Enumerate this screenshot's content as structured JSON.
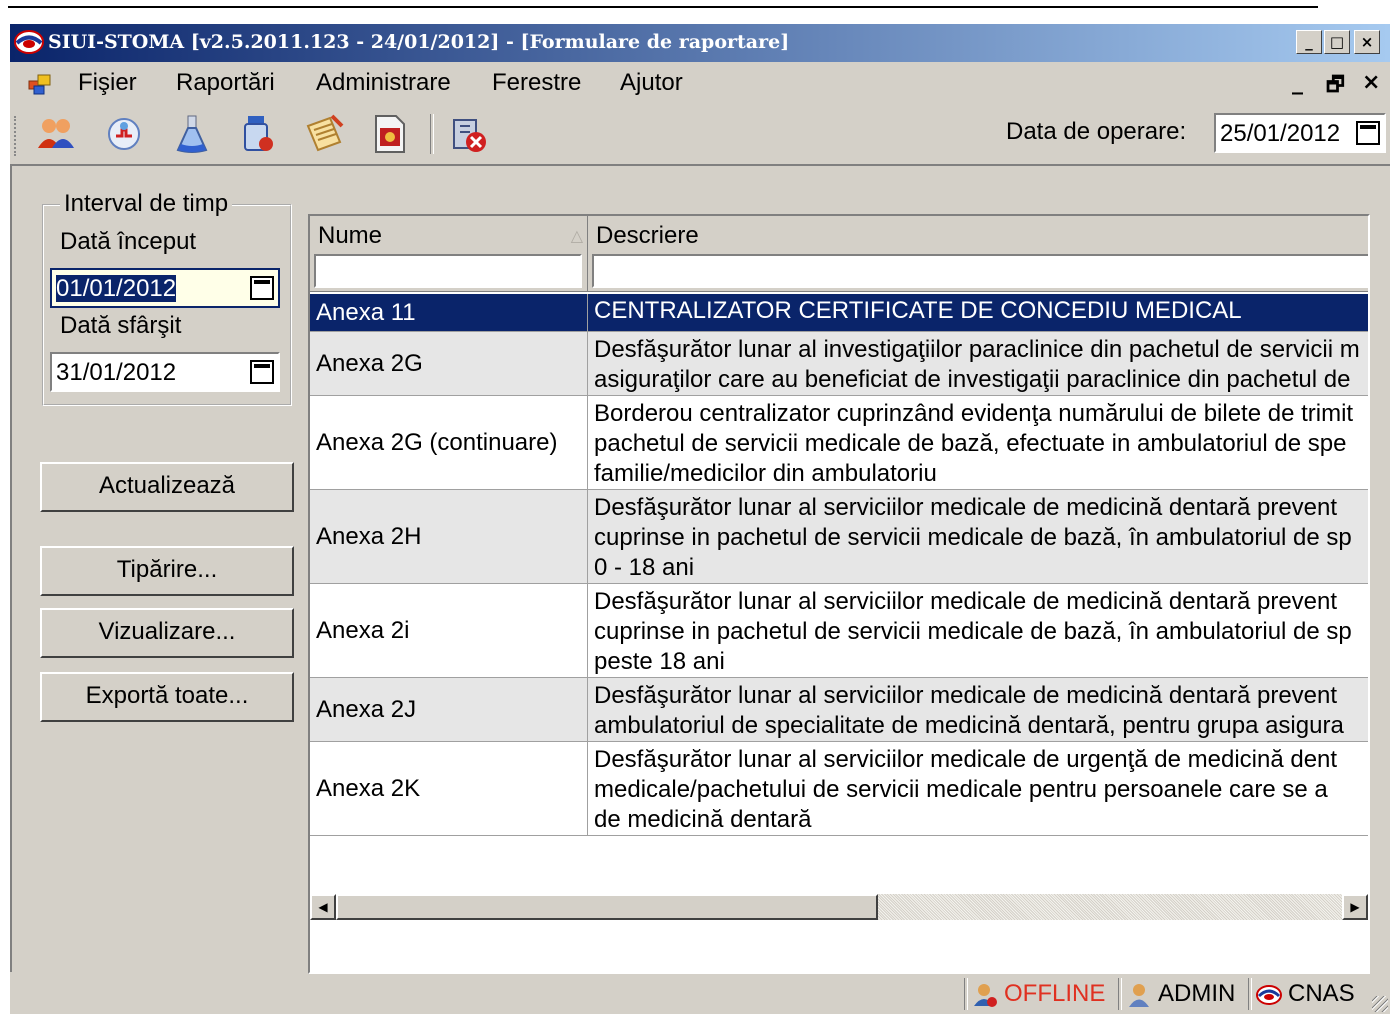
{
  "window": {
    "title": "SIUI-STOMA [v2.5.2011.123 - 24/01/2012] - [Formulare de raportare]",
    "minimize": "_",
    "maximize": "□",
    "close": "×"
  },
  "menu": {
    "items": [
      "Fişier",
      "Raportări",
      "Administrare",
      "Ferestre",
      "Ajutor"
    ],
    "mdi_minimize": "_",
    "mdi_restore": "🗗",
    "mdi_close": "×"
  },
  "toolbar": {
    "icons": [
      "users-icon",
      "medical-cross-icon",
      "lab-flask-icon",
      "medicine-bottle-icon",
      "notepad-icon",
      "document-certificate-icon",
      "exit-icon"
    ],
    "operation_date_label": "Data de operare:",
    "operation_date": "25/01/2012"
  },
  "sidebar": {
    "interval_legend": "Interval de timp",
    "start_label": "Dată început",
    "start_value": "01/01/2012",
    "end_label": "Dată sfârşit",
    "end_value": "31/01/2012",
    "buttons": {
      "refresh": "Actualizează",
      "print": "Tipărire...",
      "preview": "Vizualizare...",
      "export": "Exportă toate..."
    }
  },
  "grid": {
    "columns": [
      "Nume",
      "Descriere"
    ],
    "sort_indicator": "△",
    "rows": [
      {
        "name": "Anexa 11",
        "description": "CENTRALIZATOR CERTIFICATE DE CONCEDIU MEDICAL"
      },
      {
        "name": "Anexa 2G",
        "description": "Desfăşurător lunar al investigaţiilor paraclinice din pachetul de servicii m\nasiguraţilor care au beneficiat de investigaţii paraclinice din pachetul de"
      },
      {
        "name": "Anexa 2G (continuare)",
        "description": "Borderou centralizator cuprinzând evidenţa numărului de bilete de trimit\npachetul de servicii medicale de bază, efectuate in ambulatoriul de spe\nfamilie/medicilor din ambulatoriu"
      },
      {
        "name": "Anexa 2H",
        "description": "Desfăşurător lunar al serviciilor medicale de medicină dentară prevent\ncuprinse in pachetul de servicii medicale de bază, în ambulatoriul de sp\n0 - 18 ani"
      },
      {
        "name": "Anexa 2i",
        "description": "Desfăşurător lunar al serviciilor medicale de medicină dentară prevent\ncuprinse in pachetul de servicii medicale de bază, în ambulatoriul de sp\npeste 18 ani"
      },
      {
        "name": "Anexa 2J",
        "description": "Desfăşurător lunar al serviciilor medicale de medicină dentară prevent\nambulatoriul de specialitate de medicină dentară, pentru grupa asigura"
      },
      {
        "name": "Anexa 2K",
        "description": "Desfăşurător lunar al serviciilor medicale de urgenţă de medicină dent\nmedicale/pachetului de servicii medicale pentru persoanele care se a\nde medicină dentară"
      }
    ]
  },
  "status": {
    "connection": "OFFLINE",
    "connection_color": "#e03020",
    "user": "ADMIN",
    "org": "CNAS"
  },
  "colors": {
    "selection": "#0a246a",
    "window_bg": "#d4d0c8"
  }
}
